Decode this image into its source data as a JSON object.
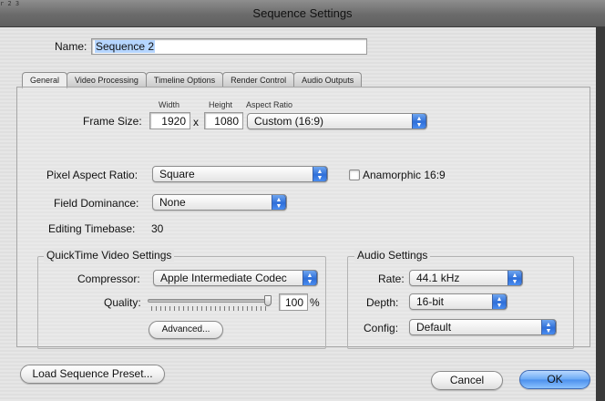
{
  "window": {
    "title": "Sequence Settings",
    "corner_text": "r 2 3"
  },
  "name_row": {
    "label": "Name:",
    "value": "Sequence 2"
  },
  "tabs": [
    {
      "label": "General",
      "active": true
    },
    {
      "label": "Video Processing",
      "active": false
    },
    {
      "label": "Timeline Options",
      "active": false
    },
    {
      "label": "Render Control",
      "active": false
    },
    {
      "label": "Audio Outputs",
      "active": false
    }
  ],
  "general": {
    "frame_size": {
      "label": "Frame Size:",
      "width_caption": "Width",
      "height_caption": "Height",
      "aspect_caption": "Aspect Ratio",
      "width": "1920",
      "separator": "x",
      "height": "1080",
      "aspect_ratio": "Custom (16:9)"
    },
    "pixel_aspect": {
      "label": "Pixel Aspect Ratio:",
      "value": "Square",
      "anamorphic_label": "Anamorphic 16:9",
      "anamorphic_checked": false
    },
    "field_dominance": {
      "label": "Field Dominance:",
      "value": "None"
    },
    "editing_timebase": {
      "label": "Editing Timebase:",
      "value": "30"
    }
  },
  "quicktime": {
    "title": "QuickTime Video Settings",
    "compressor_label": "Compressor:",
    "compressor_value": "Apple Intermediate Codec",
    "quality_label": "Quality:",
    "quality_value": "100",
    "quality_unit": "%",
    "advanced_button": "Advanced..."
  },
  "audio": {
    "title": "Audio Settings",
    "rate_label": "Rate:",
    "rate_value": "44.1 kHz",
    "depth_label": "Depth:",
    "depth_value": "16-bit",
    "config_label": "Config:",
    "config_value": "Default"
  },
  "footer": {
    "load_preset_button": "Load Sequence Preset...",
    "cancel_button": "Cancel",
    "ok_button": "OK"
  },
  "icons": {
    "popup_arrows": "updown-arrows-icon",
    "slider": "slider-thumb-icon"
  },
  "colors": {
    "accent_blue": "#4b8fec",
    "selection": "#b5d5ff"
  }
}
